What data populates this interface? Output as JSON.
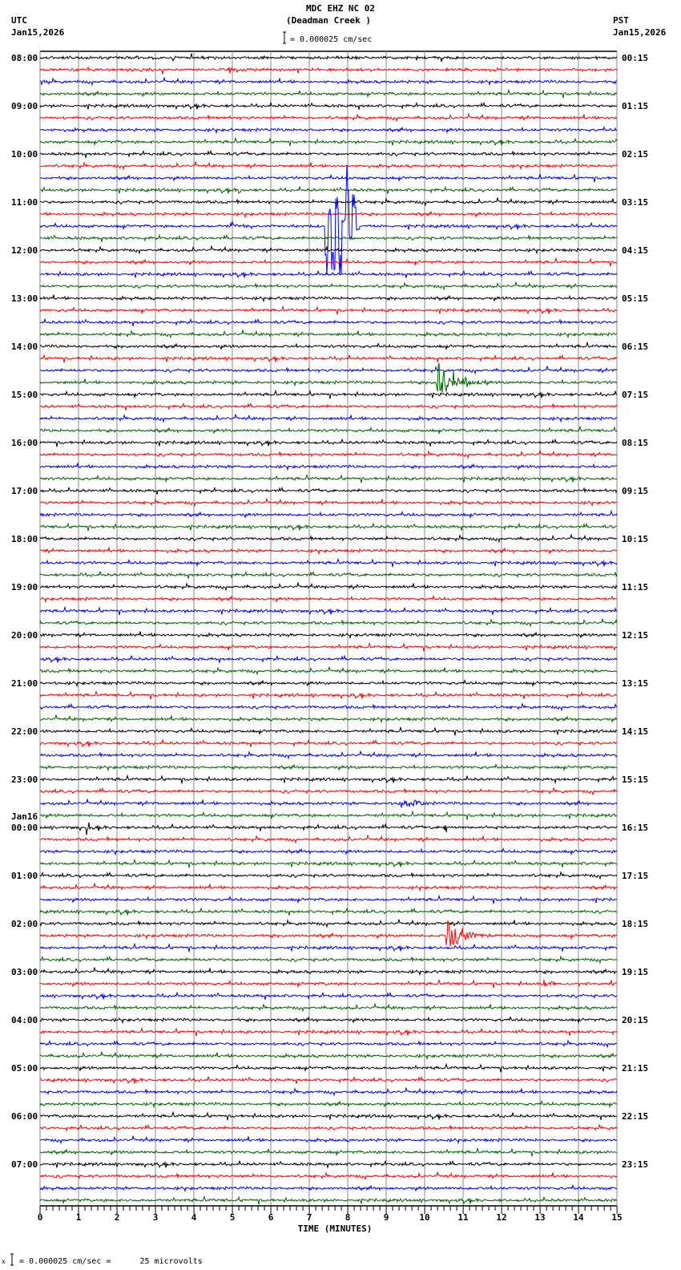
{
  "header": {
    "title": "MDC EHZ NC 02",
    "subtitle": "(Deadman Creek )",
    "left_tz": "UTC",
    "left_date": "Jan15,2026",
    "right_tz": "PST",
    "right_date": "Jan15,2026",
    "scale_text": "= 0.000025 cm/sec"
  },
  "footer": {
    "scale_text": "= 0.000025 cm/sec =      25 microvolts",
    "prefix_glyph": "x"
  },
  "chart_data": {
    "type": "line",
    "title": "MDC EHZ NC 02 (Deadman Creek )",
    "xlabel": "TIME (MINUTES)",
    "xlim": [
      0,
      15
    ],
    "xticks": [
      "0",
      "1",
      "2",
      "3",
      "4",
      "5",
      "6",
      "7",
      "8",
      "9",
      "10",
      "11",
      "12",
      "13",
      "14",
      "15"
    ],
    "minor_tick_interval_min": 0.1667,
    "grid": true,
    "trace_minutes": 15,
    "trace_count": 96,
    "trace_colors": [
      "#000000",
      "#ff0000",
      "#0000ff",
      "#006400"
    ],
    "date_change_label": "Jan16",
    "left_labels": [
      "08:00",
      "09:00",
      "10:00",
      "11:00",
      "12:00",
      "13:00",
      "14:00",
      "15:00",
      "16:00",
      "17:00",
      "18:00",
      "19:00",
      "20:00",
      "21:00",
      "22:00",
      "23:00",
      "00:00",
      "01:00",
      "02:00",
      "03:00",
      "04:00",
      "05:00",
      "06:00",
      "07:00"
    ],
    "right_labels": [
      "00:15",
      "01:15",
      "02:15",
      "03:15",
      "04:15",
      "05:15",
      "06:15",
      "07:15",
      "08:15",
      "09:15",
      "10:15",
      "11:15",
      "12:15",
      "13:15",
      "14:15",
      "15:15",
      "16:15",
      "17:15",
      "18:15",
      "19:15",
      "20:15",
      "21:15",
      "22:15",
      "23:15"
    ],
    "events": [
      {
        "trace_index": 14,
        "utc": "11:30",
        "start_min": 7.4,
        "end_min": 8.3,
        "type": "spikes",
        "relative_amplitude": 60
      },
      {
        "trace_index": 14,
        "utc": "11:30",
        "start_min": 4.95,
        "end_min": 5.15,
        "type": "burst",
        "relative_amplitude": 4
      },
      {
        "trace_index": 27,
        "utc": "14:45",
        "start_min": 10.3,
        "end_min": 11.6,
        "type": "quake",
        "relative_amplitude": 25
      },
      {
        "trace_index": 73,
        "utc": "02:15",
        "start_min": 10.55,
        "end_min": 11.7,
        "type": "quake",
        "relative_amplitude": 25
      },
      {
        "trace_index": 77,
        "utc": "03:15",
        "start_min": 13.1,
        "end_min": 13.9,
        "type": "quake",
        "relative_amplitude": 5
      },
      {
        "trace_index": 62,
        "utc": "23:30",
        "start_min": 9.3,
        "end_min": 10.0,
        "type": "burst",
        "relative_amplitude": 2.5
      },
      {
        "trace_index": 64,
        "utc": "00:00",
        "start_min": 1.2,
        "end_min": 1.3,
        "type": "burst",
        "relative_amplitude": 6
      },
      {
        "trace_index": 64,
        "utc": "00:00",
        "start_min": 10.5,
        "end_min": 10.6,
        "type": "burst",
        "relative_amplitude": 5
      },
      {
        "trace_index": 11,
        "utc": "10:45",
        "start_min": 5.15,
        "end_min": 5.25,
        "type": "burst",
        "relative_amplitude": 4
      }
    ]
  }
}
